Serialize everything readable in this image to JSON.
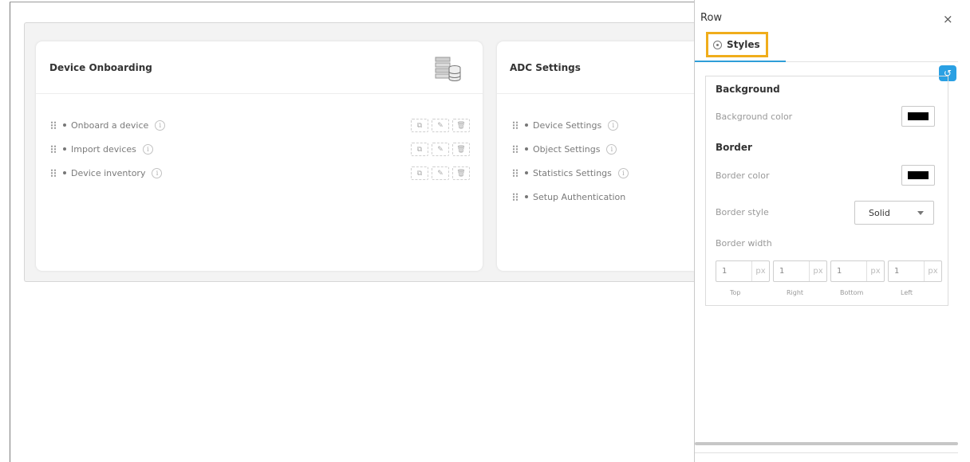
{
  "cards": [
    {
      "title": "Device Onboarding",
      "icon": "database-icon",
      "items": [
        {
          "label": "Onboard a device",
          "info": "i"
        },
        {
          "label": "Import devices",
          "info": "i"
        },
        {
          "label": "Device inventory",
          "info": "i"
        }
      ]
    },
    {
      "title": "ADC Settings",
      "items": [
        {
          "label": "Device Settings",
          "info": "i"
        },
        {
          "label": "Object Settings",
          "info": "i"
        },
        {
          "label": "Statistics Settings",
          "info": "i"
        },
        {
          "label": "Setup Authentication"
        }
      ]
    }
  ],
  "panel": {
    "title": "Row",
    "close_glyph": "×",
    "tab_label": "Styles",
    "undo_glyph": "↺",
    "background_section": "Background",
    "background_color_label": "Background color",
    "background_color_value": "#000000",
    "border_section": "Border",
    "border_color_label": "Border color",
    "border_color_value": "#000000",
    "border_style_label": "Border style",
    "border_style_value": "Solid",
    "border_width_label": "Border width",
    "widths": [
      {
        "value": "1",
        "unit": "px",
        "caption": "Top"
      },
      {
        "value": "1",
        "unit": "px",
        "caption": "Right"
      },
      {
        "value": "1",
        "unit": "px",
        "caption": "Bottom"
      },
      {
        "value": "1",
        "unit": "px",
        "caption": "Left"
      }
    ]
  },
  "colors": {
    "accent": "#2f9ed8",
    "tab_highlight": "#f0ad1b"
  }
}
